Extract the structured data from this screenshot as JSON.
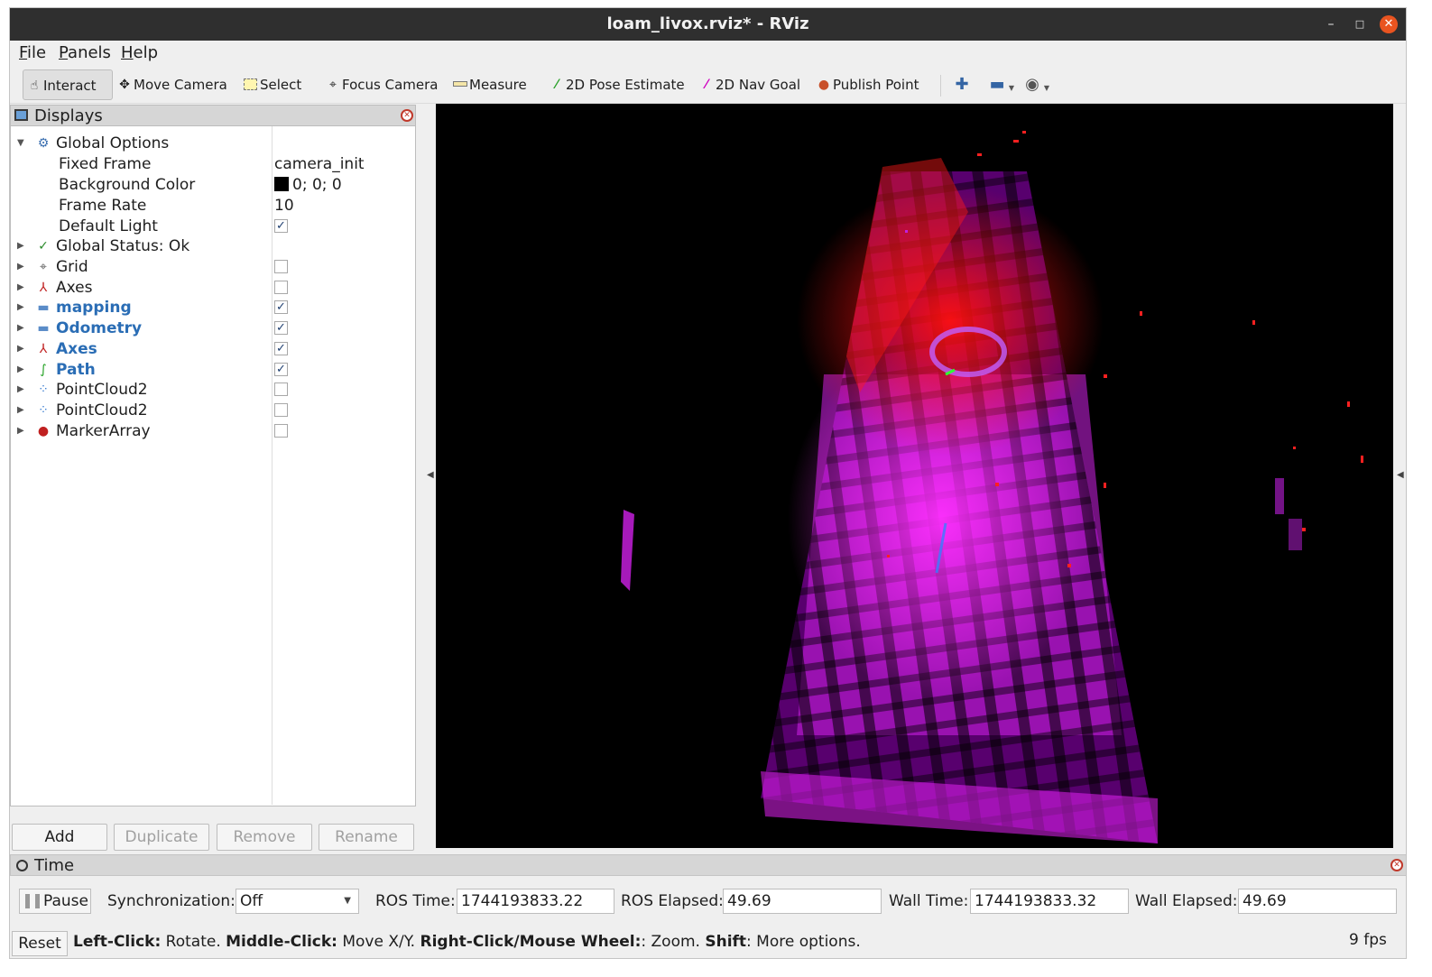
{
  "window": {
    "title": "loam_livox.rviz* - RViz",
    "controls": {
      "minimize": "–",
      "maximize": "□",
      "close": "✕"
    }
  },
  "menu": {
    "file": {
      "mnemonic": "F",
      "rest": "ile"
    },
    "panels": {
      "mnemonic": "P",
      "rest": "anels"
    },
    "help": {
      "mnemonic": "H",
      "rest": "elp"
    }
  },
  "toolbar": {
    "interact": "Interact",
    "move_camera": "Move Camera",
    "select": "Select",
    "focus_camera": "Focus Camera",
    "measure": "Measure",
    "pose_estimate": "2D Pose Estimate",
    "nav_goal": "2D Nav Goal",
    "publish_point": "Publish Point"
  },
  "displays": {
    "title": "Displays",
    "global_options": {
      "label": "Global Options",
      "fixed_frame": {
        "label": "Fixed Frame",
        "value": "camera_init"
      },
      "background_color": {
        "label": "Background Color",
        "value": "0; 0; 0",
        "swatch": "#000000"
      },
      "frame_rate": {
        "label": "Frame Rate",
        "value": "10"
      },
      "default_light": {
        "label": "Default Light",
        "checked": true
      }
    },
    "global_status": "Global Status: Ok",
    "items": [
      {
        "label": "Grid",
        "icon": "grid-icon",
        "checked": false,
        "bold": false
      },
      {
        "label": "Axes",
        "icon": "axes-icon",
        "checked": false,
        "bold": false
      },
      {
        "label": "mapping",
        "icon": "folder-icon",
        "checked": true,
        "bold": true
      },
      {
        "label": "Odometry",
        "icon": "folder-icon",
        "checked": true,
        "bold": true
      },
      {
        "label": "Axes",
        "icon": "axes-icon",
        "checked": true,
        "bold": true
      },
      {
        "label": "Path",
        "icon": "path-icon",
        "checked": true,
        "bold": true
      },
      {
        "label": "PointCloud2",
        "icon": "pointcloud-icon",
        "checked": false,
        "bold": false
      },
      {
        "label": "PointCloud2",
        "icon": "pointcloud-icon",
        "checked": false,
        "bold": false
      },
      {
        "label": "MarkerArray",
        "icon": "marker-array-icon",
        "checked": false,
        "bold": false
      }
    ],
    "buttons": {
      "add": "Add",
      "duplicate": "Duplicate",
      "remove": "Remove",
      "rename": "Rename"
    }
  },
  "time": {
    "title": "Time",
    "pause": "Pause",
    "sync_label": "Synchronization:",
    "sync_value": "Off",
    "ros_time_label": "ROS Time:",
    "ros_time": "1744193833.22",
    "ros_elapsed_label": "ROS Elapsed:",
    "ros_elapsed": "49.69",
    "wall_time_label": "Wall Time:",
    "wall_time": "1744193833.32",
    "wall_elapsed_label": "Wall Elapsed:",
    "wall_elapsed": "49.69"
  },
  "status": {
    "reset": "Reset",
    "hint_parts": [
      {
        "b": "Left-Click:",
        "t": " Rotate. "
      },
      {
        "b": "Middle-Click:",
        "t": " Move X/Y. "
      },
      {
        "b": "Right-Click/Mouse Wheel:",
        "t": ": Zoom. "
      },
      {
        "b": "Shift",
        "t": ": More options."
      }
    ],
    "fps": "9 fps"
  },
  "viewport": {
    "background": "#000000",
    "cloud_colors": [
      "#ff1a1a",
      "#ff00ff",
      "#c000e0",
      "#e000a0"
    ]
  }
}
